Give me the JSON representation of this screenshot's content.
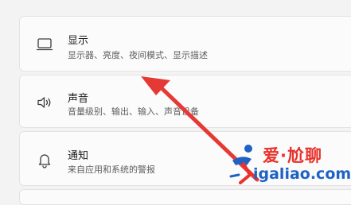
{
  "settings": {
    "items": [
      {
        "icon": "laptop-icon",
        "title": "显示",
        "description": "显示器、亮度、夜间模式、显示描述"
      },
      {
        "icon": "speaker-icon",
        "title": "声音",
        "description": "音量级别、输出、输入、声音设备"
      },
      {
        "icon": "bell-icon",
        "title": "通知",
        "description": "来自应用和系统的警报"
      }
    ]
  },
  "annotation": {
    "arrow_color": "#e53935"
  },
  "watermark": {
    "top_text": "爱·尬聊",
    "bottom_text": "igaliao.com",
    "colors": {
      "red": "#e8322c",
      "blue": "#1e63c4"
    }
  }
}
